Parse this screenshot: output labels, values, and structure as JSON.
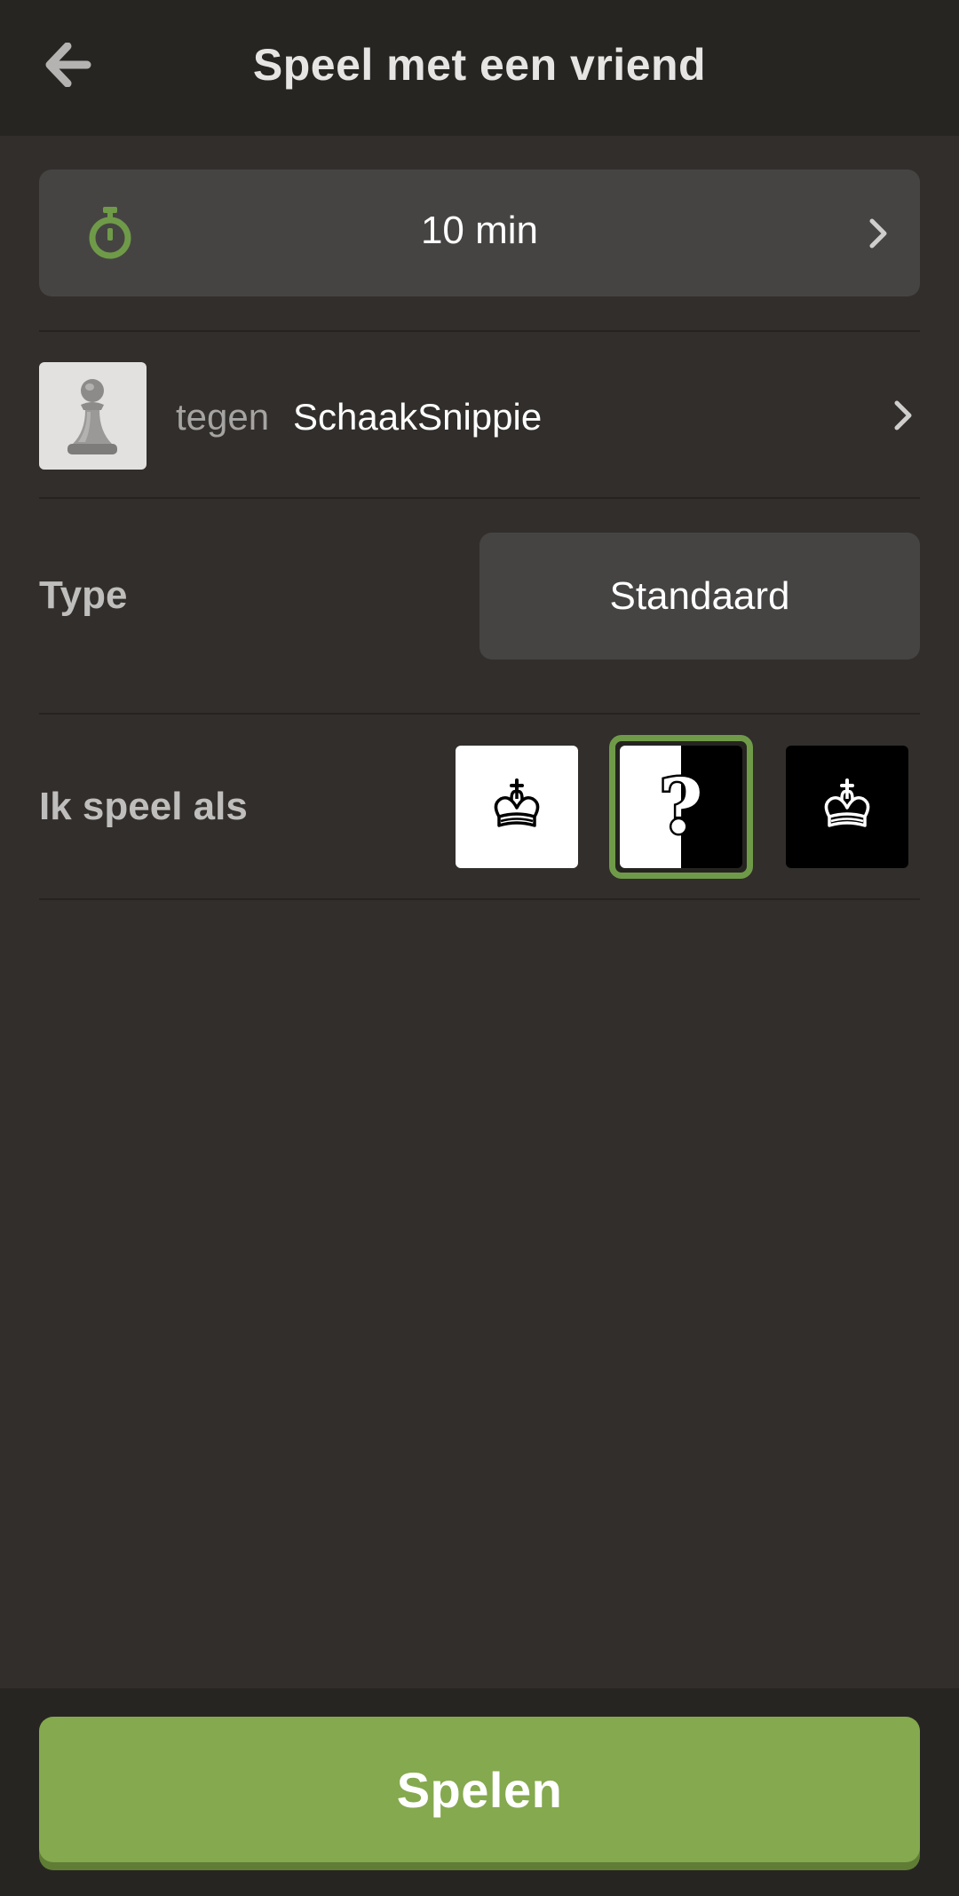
{
  "header": {
    "title": "Speel met een vriend",
    "back_icon": "arrow-left-icon"
  },
  "time_control": {
    "label": "10 min",
    "icon": "stopwatch-icon",
    "accent_color": "#6f9b49"
  },
  "opponent": {
    "prefix": "tegen",
    "name": "SchaakSnippie",
    "avatar_icon": "pawn-avatar-icon"
  },
  "type": {
    "label": "Type",
    "value": "Standaard"
  },
  "color": {
    "label": "Ik speel als",
    "options": [
      {
        "id": "white",
        "icon": "white-king-icon",
        "glyph": "♔"
      },
      {
        "id": "random",
        "icon": "question-mark-icon",
        "glyph": "?"
      },
      {
        "id": "black",
        "icon": "black-king-icon",
        "glyph": "♚"
      }
    ],
    "selected": "random"
  },
  "play": {
    "label": "Spelen",
    "color": "#85a94e"
  }
}
